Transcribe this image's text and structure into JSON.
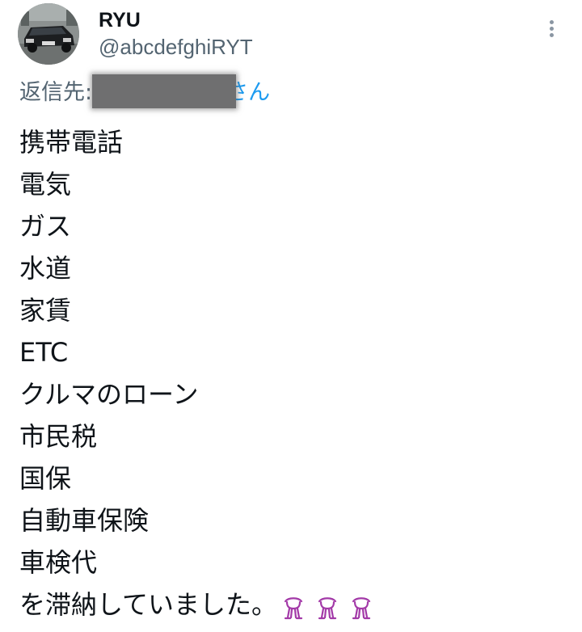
{
  "author": {
    "name": "RYU",
    "handle": "@abcdefghiRYT",
    "avatar_icon": "car-avatar-icon"
  },
  "menu": {
    "icon": "more-vertical-icon"
  },
  "reply": {
    "label": "返信先:",
    "target_visible_suffix": "さん",
    "target_color": "#1d9bf0"
  },
  "tweet": {
    "lines": [
      "携帯電話",
      "電気",
      "ガス",
      "水道",
      "家賃",
      "ETC",
      "クルマのローン",
      "市民税",
      "国保",
      "自動車保険",
      "車検代",
      "を滞納していました。"
    ],
    "emojis": [
      "bowing-person-icon",
      "bowing-person-icon",
      "bowing-person-icon"
    ],
    "emoji_color": "#a33aa8"
  },
  "colors": {
    "text": "#0f1419",
    "secondary": "#536471",
    "link": "#1d9bf0"
  }
}
